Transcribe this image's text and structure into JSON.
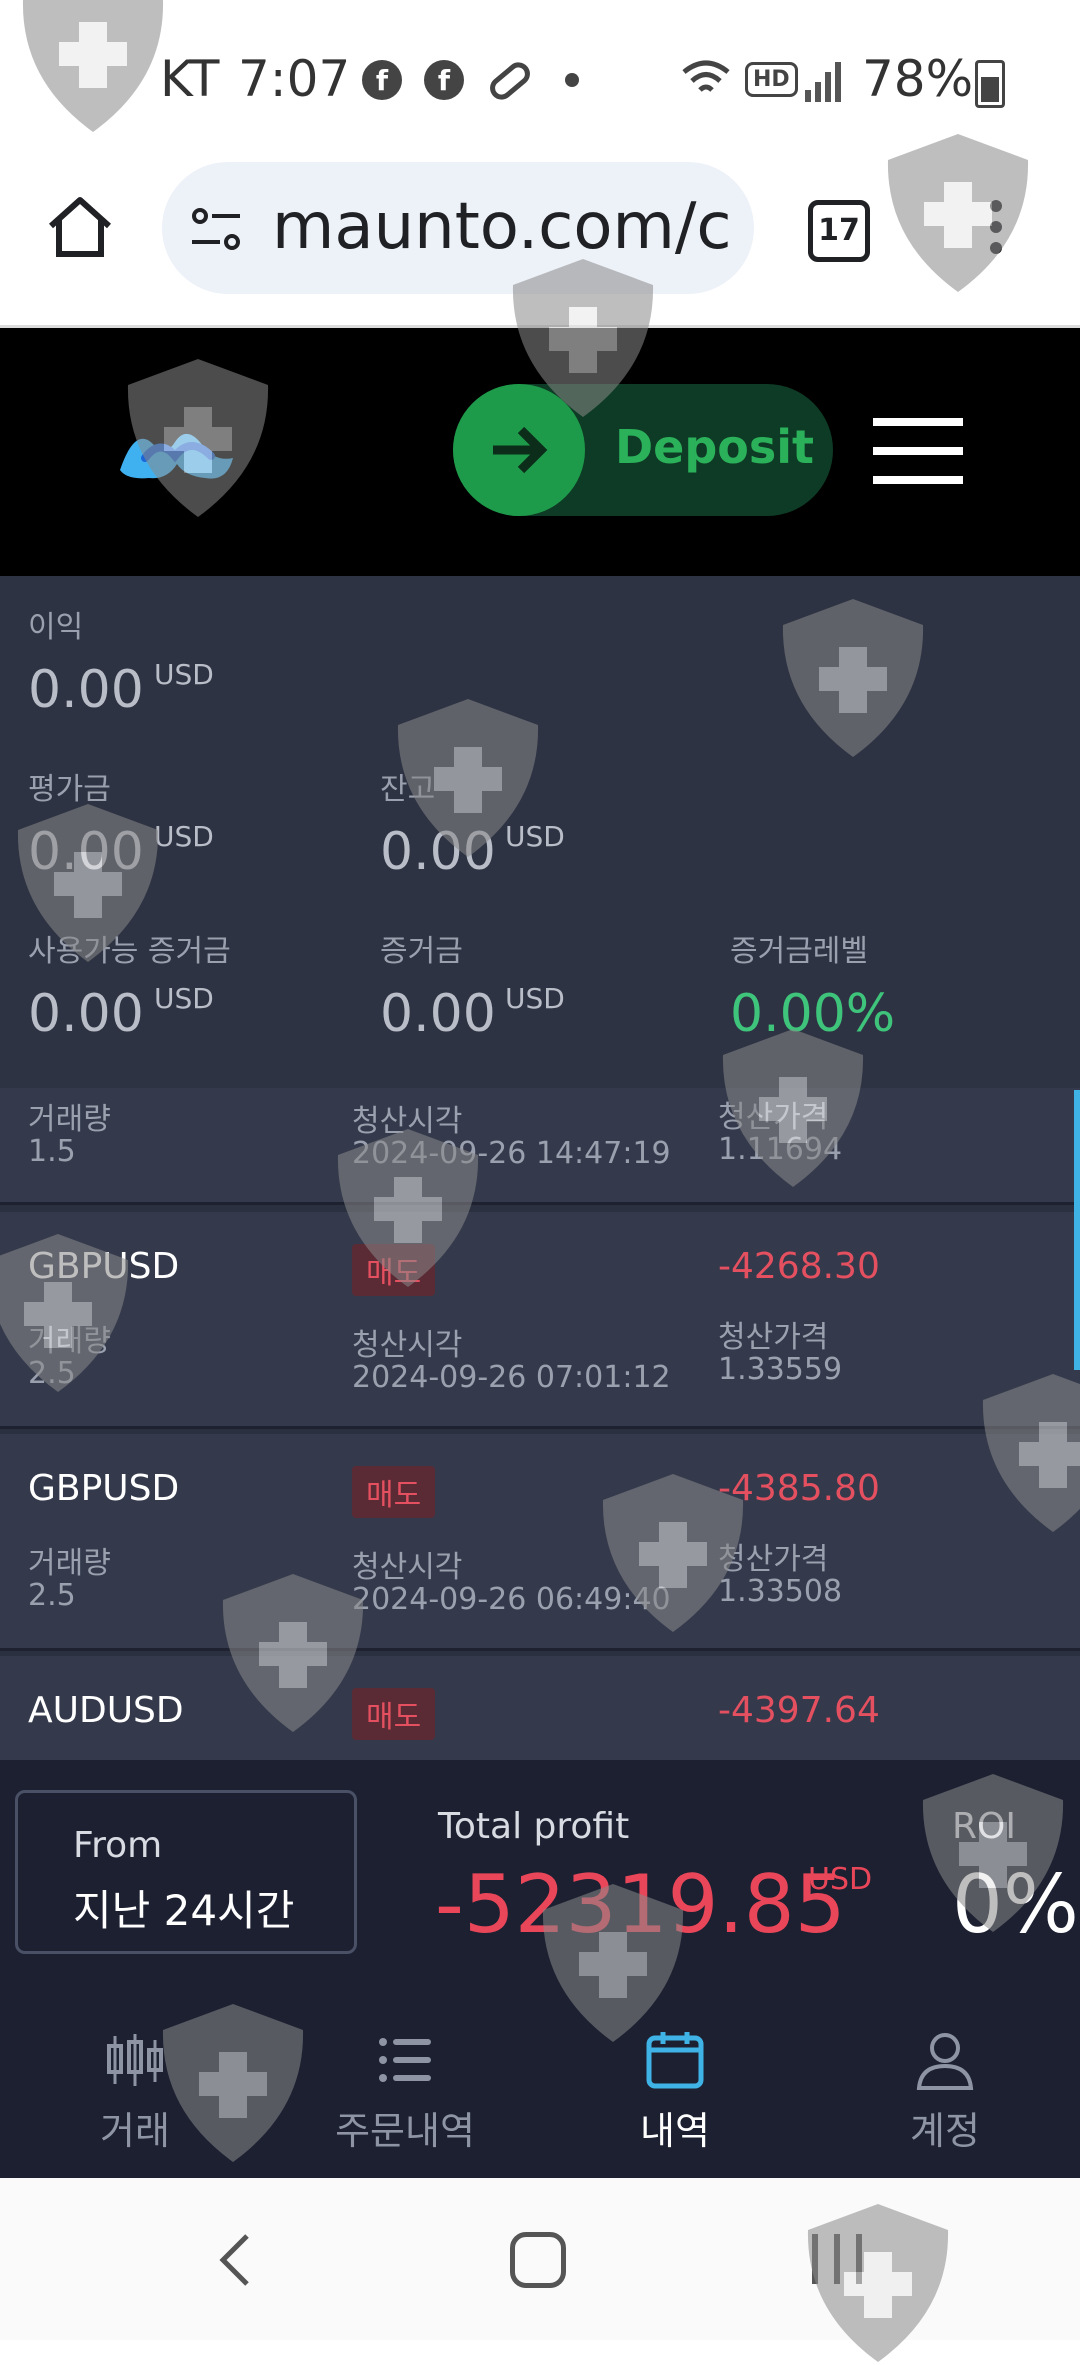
{
  "status_bar": {
    "carrier": "KT",
    "time": "7:07",
    "hd": "HD",
    "battery": "78%"
  },
  "browser": {
    "url": "maunto.com/c",
    "tab_count": "17"
  },
  "header": {
    "deposit_label": "Deposit"
  },
  "summary": {
    "profit": {
      "label": "이익",
      "value": "0.00",
      "unit": "USD"
    },
    "equity": {
      "label": "평가금",
      "value": "0.00",
      "unit": "USD"
    },
    "balance": {
      "label": "잔고",
      "value": "0.00",
      "unit": "USD"
    },
    "free_margin": {
      "label": "사용가능 증거금",
      "value": "0.00",
      "unit": "USD"
    },
    "margin": {
      "label": "증거금",
      "value": "0.00",
      "unit": "USD"
    },
    "margin_level": {
      "label": "증거금레벨",
      "value": "0.00%",
      "color": "#3ec47b"
    }
  },
  "trades_labels": {
    "volume": "거래량",
    "close_time": "청산시각",
    "close_price": "청산가격"
  },
  "trades": [
    {
      "symbol": "",
      "side": "",
      "profit": "",
      "volume": "1.5",
      "close_time": "2024-09-26 14:47:19",
      "close_price": "1.11694"
    },
    {
      "symbol": "GBPUSD",
      "side": "매도",
      "profit": "-4268.30",
      "volume": "2.5",
      "close_time": "2024-09-26 07:01:12",
      "close_price": "1.33559"
    },
    {
      "symbol": "GBPUSD",
      "side": "매도",
      "profit": "-4385.80",
      "volume": "2.5",
      "close_time": "2024-09-26 06:49:40",
      "close_price": "1.33508"
    },
    {
      "symbol": "AUDUSD",
      "side": "매도",
      "profit": "-4397.64",
      "volume": "",
      "close_time": "",
      "close_price": ""
    }
  ],
  "totals": {
    "from_label": "From",
    "from_value": "지난 24시간",
    "total_profit_label": "Total profit",
    "total_profit_value": "-52319.85",
    "total_profit_unit": "USD",
    "roi_label": "ROI",
    "roi_value": "0%"
  },
  "bottom_nav": [
    {
      "label": "거래",
      "icon": "candlestick-icon",
      "active": false
    },
    {
      "label": "주문내역",
      "icon": "list-icon",
      "active": false
    },
    {
      "label": "내역",
      "icon": "calendar-icon",
      "active": true
    },
    {
      "label": "계정",
      "icon": "person-icon",
      "active": false
    }
  ],
  "colors": {
    "loss": "#e94759",
    "active_nav": "#3fb3e6",
    "deposit_green": "#1e9b4a"
  }
}
